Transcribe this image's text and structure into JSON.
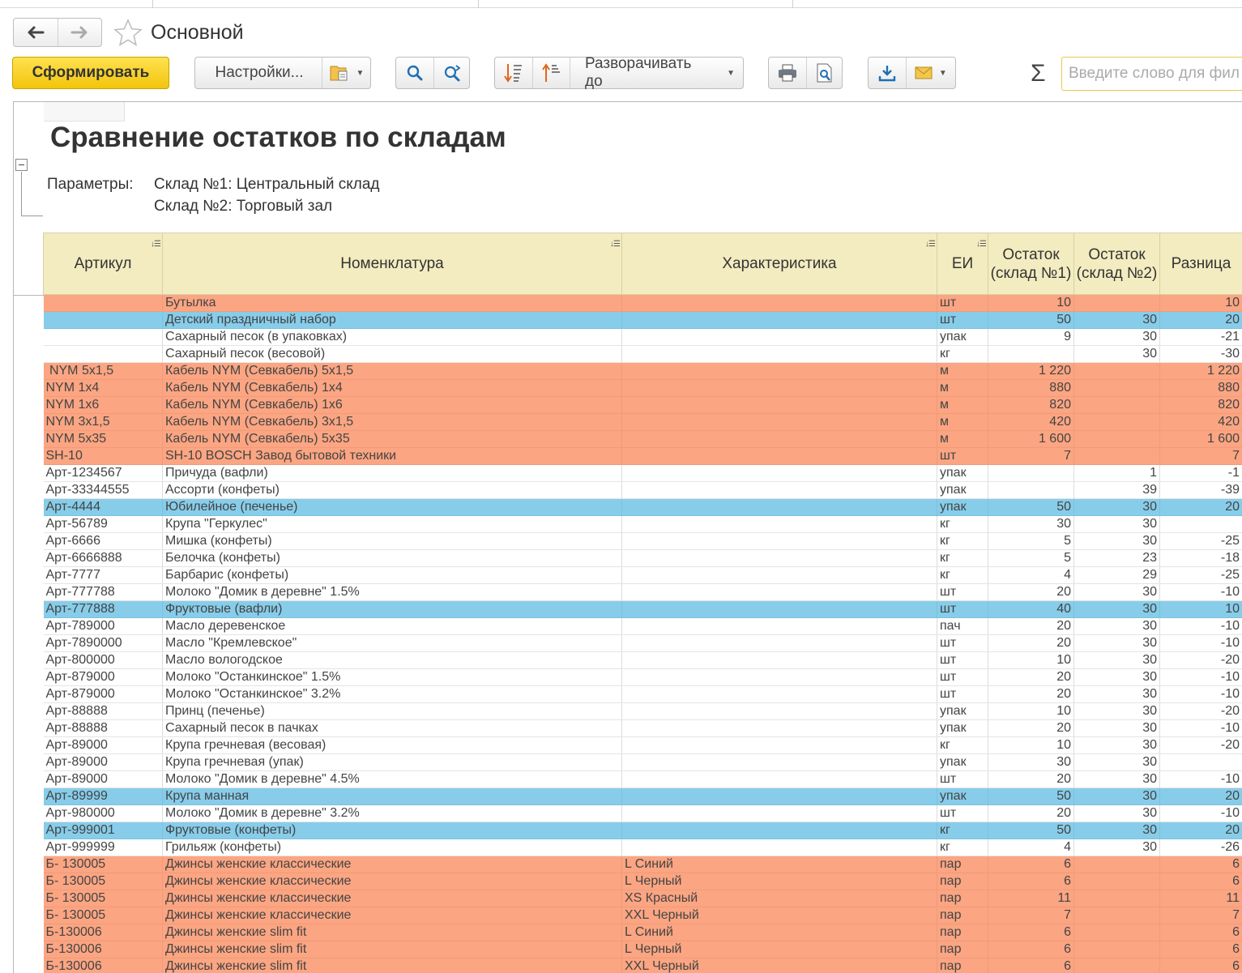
{
  "window": {
    "title": "Основной"
  },
  "toolbar": {
    "generate_label": "Сформировать",
    "settings_label": "Настройки...",
    "expand_label": "Разворачивать до",
    "search_placeholder": "Введите слово для фил"
  },
  "report": {
    "title": "Сравнение остатков по складам",
    "params_label": "Параметры:",
    "params": [
      "Склад №1: Центральный склад",
      "Склад №2: Торговый зал"
    ],
    "columns": [
      "Артикул",
      "Номенклатура",
      "Характеристика",
      "ЕИ",
      "Остаток (склад №1)",
      "Остаток (склад №2)",
      "Разница"
    ],
    "rows": [
      {
        "c": "red",
        "art": "",
        "name": "Бутылка",
        "char": "",
        "unit": "шт",
        "s1": "10",
        "s2": "",
        "diff": "10"
      },
      {
        "c": "blue",
        "art": "",
        "name": "Детский праздничный набор",
        "char": "",
        "unit": "шт",
        "s1": "50",
        "s2": "30",
        "diff": "20"
      },
      {
        "c": "white",
        "art": "",
        "name": "Сахарный песок (в упаковках)",
        "char": "",
        "unit": "упак",
        "s1": "9",
        "s2": "30",
        "diff": "-21"
      },
      {
        "c": "white",
        "art": "",
        "name": "Сахарный песок (весовой)",
        "char": "",
        "unit": "кг",
        "s1": "",
        "s2": "30",
        "diff": "-30"
      },
      {
        "c": "red",
        "art": " NYM 5х1,5",
        "name": "Кабель NYM (Севкабель) 5х1,5",
        "char": "",
        "unit": "м",
        "s1": "1 220",
        "s2": "",
        "diff": "1 220"
      },
      {
        "c": "red",
        "art": "NYM 1х4",
        "name": "Кабель NYM (Севкабель) 1х4",
        "char": "",
        "unit": "м",
        "s1": "880",
        "s2": "",
        "diff": "880"
      },
      {
        "c": "red",
        "art": "NYM 1х6",
        "name": "Кабель NYM (Севкабель) 1х6",
        "char": "",
        "unit": "м",
        "s1": "820",
        "s2": "",
        "diff": "820"
      },
      {
        "c": "red",
        "art": "NYM 3х1,5",
        "name": "Кабель NYM (Севкабель) 3х1,5",
        "char": "",
        "unit": "м",
        "s1": "420",
        "s2": "",
        "diff": "420"
      },
      {
        "c": "red",
        "art": "NYM 5х35",
        "name": "Кабель NYM (Севкабель) 5х35",
        "char": "",
        "unit": "м",
        "s1": "1 600",
        "s2": "",
        "diff": "1 600"
      },
      {
        "c": "red",
        "art": "SH-10",
        "name": "SH-10 BOSCH Завод бытовой техники",
        "char": "",
        "unit": "шт",
        "s1": "7",
        "s2": "",
        "diff": "7"
      },
      {
        "c": "white",
        "art": "Арт-1234567",
        "name": "Причуда (вафли)",
        "char": "",
        "unit": "упак",
        "s1": "",
        "s2": "1",
        "diff": "-1"
      },
      {
        "c": "white",
        "art": "Арт-33344555",
        "name": "Ассорти (конфеты)",
        "char": "",
        "unit": "упак",
        "s1": "",
        "s2": "39",
        "diff": "-39"
      },
      {
        "c": "blue",
        "art": "Арт-4444",
        "name": "Юбилейное (печенье)",
        "char": "",
        "unit": "упак",
        "s1": "50",
        "s2": "30",
        "diff": "20"
      },
      {
        "c": "white",
        "art": "Арт-56789",
        "name": "Крупа \"Геркулес\"",
        "char": "",
        "unit": "кг",
        "s1": "30",
        "s2": "30",
        "diff": ""
      },
      {
        "c": "white",
        "art": "Арт-6666",
        "name": "Мишка (конфеты)",
        "char": "",
        "unit": "кг",
        "s1": "5",
        "s2": "30",
        "diff": "-25"
      },
      {
        "c": "white",
        "art": "Арт-6666888",
        "name": "Белочка (конфеты)",
        "char": "",
        "unit": "кг",
        "s1": "5",
        "s2": "23",
        "diff": "-18"
      },
      {
        "c": "white",
        "art": "Арт-7777",
        "name": "Барбарис (конфеты)",
        "char": "",
        "unit": "кг",
        "s1": "4",
        "s2": "29",
        "diff": "-25"
      },
      {
        "c": "white",
        "art": "Арт-777788",
        "name": "Молоко \"Домик в деревне\" 1.5%",
        "char": "",
        "unit": "шт",
        "s1": "20",
        "s2": "30",
        "diff": "-10"
      },
      {
        "c": "blue",
        "art": "Арт-777888",
        "name": "Фруктовые (вафли)",
        "char": "",
        "unit": "шт",
        "s1": "40",
        "s2": "30",
        "diff": "10"
      },
      {
        "c": "white",
        "art": "Арт-789000",
        "name": "Масло деревенское",
        "char": "",
        "unit": "пач",
        "s1": "20",
        "s2": "30",
        "diff": "-10"
      },
      {
        "c": "white",
        "art": "Арт-7890000",
        "name": "Масло \"Кремлевское\"",
        "char": "",
        "unit": "шт",
        "s1": "20",
        "s2": "30",
        "diff": "-10"
      },
      {
        "c": "white",
        "art": "Арт-800000",
        "name": "Масло вологодское",
        "char": "",
        "unit": "шт",
        "s1": "10",
        "s2": "30",
        "diff": "-20"
      },
      {
        "c": "white",
        "art": "Арт-879000",
        "name": "Молоко \"Останкинское\" 1.5%",
        "char": "",
        "unit": "шт",
        "s1": "20",
        "s2": "30",
        "diff": "-10"
      },
      {
        "c": "white",
        "art": "Арт-879000",
        "name": "Молоко \"Останкинское\" 3.2%",
        "char": "",
        "unit": "шт",
        "s1": "20",
        "s2": "30",
        "diff": "-10"
      },
      {
        "c": "white",
        "art": "Арт-88888",
        "name": "Принц (печенье)",
        "char": "",
        "unit": "упак",
        "s1": "10",
        "s2": "30",
        "diff": "-20"
      },
      {
        "c": "white",
        "art": "Арт-88888",
        "name": "Сахарный песок в пачках",
        "char": "",
        "unit": "упак",
        "s1": "20",
        "s2": "30",
        "diff": "-10"
      },
      {
        "c": "white",
        "art": "Арт-89000",
        "name": "Крупа гречневая (весовая)",
        "char": "",
        "unit": "кг",
        "s1": "10",
        "s2": "30",
        "diff": "-20"
      },
      {
        "c": "white",
        "art": "Арт-89000",
        "name": "Крупа гречневая (упак)",
        "char": "",
        "unit": "упак",
        "s1": "30",
        "s2": "30",
        "diff": ""
      },
      {
        "c": "white",
        "art": "Арт-89000",
        "name": "Молоко \"Домик в деревне\" 4.5%",
        "char": "",
        "unit": "шт",
        "s1": "20",
        "s2": "30",
        "diff": "-10"
      },
      {
        "c": "blue",
        "art": "Арт-89999",
        "name": "Крупа манная",
        "char": "",
        "unit": "упак",
        "s1": "50",
        "s2": "30",
        "diff": "20"
      },
      {
        "c": "white",
        "art": "Арт-980000",
        "name": "Молоко \"Домик в деревне\" 3.2%",
        "char": "",
        "unit": "шт",
        "s1": "20",
        "s2": "30",
        "diff": "-10"
      },
      {
        "c": "blue",
        "art": "Арт-999001",
        "name": "Фруктовые (конфеты)",
        "char": "",
        "unit": "кг",
        "s1": "50",
        "s2": "30",
        "diff": "20"
      },
      {
        "c": "white",
        "art": "Арт-999999",
        "name": "Грильяж (конфеты)",
        "char": "",
        "unit": "кг",
        "s1": "4",
        "s2": "30",
        "diff": "-26"
      },
      {
        "c": "red",
        "art": "Б- 130005",
        "name": "Джинсы женские классические",
        "char": "L Синий",
        "unit": "пар",
        "s1": "6",
        "s2": "",
        "diff": "6"
      },
      {
        "c": "red",
        "art": "Б- 130005",
        "name": "Джинсы женские классические",
        "char": "L Черный",
        "unit": "пар",
        "s1": "6",
        "s2": "",
        "diff": "6"
      },
      {
        "c": "red",
        "art": "Б- 130005",
        "name": "Джинсы женские классические",
        "char": "XS Красный",
        "unit": "пар",
        "s1": "11",
        "s2": "",
        "diff": "11"
      },
      {
        "c": "red",
        "art": "Б- 130005",
        "name": "Джинсы женские классические",
        "char": "XXL Черный",
        "unit": "пар",
        "s1": "7",
        "s2": "",
        "diff": "7"
      },
      {
        "c": "red",
        "art": "Б-130006",
        "name": "Джинсы женские slim fit",
        "char": "L Синий",
        "unit": "пар",
        "s1": "6",
        "s2": "",
        "diff": "6"
      },
      {
        "c": "red",
        "art": "Б-130006",
        "name": "Джинсы женские slim fit",
        "char": "L Черный",
        "unit": "пар",
        "s1": "6",
        "s2": "",
        "diff": "6"
      },
      {
        "c": "red",
        "art": "Б-130006",
        "name": "Джинсы женские slim fit",
        "char": "XXL Черный",
        "unit": "пар",
        "s1": "6",
        "s2": "",
        "diff": "6"
      }
    ]
  },
  "colors": {
    "row_red": "#fba582",
    "row_blue": "#87cdea",
    "header_bg": "#f3ecc0",
    "primary_button": "#f2c40c"
  },
  "icons": [
    "back-arrow-icon",
    "forward-arrow-icon",
    "favorite-star-icon",
    "settings-variant-icon",
    "search-icon",
    "search-next-icon",
    "sort-descending-icon",
    "sort-ascending-icon",
    "print-icon",
    "print-preview-icon",
    "save-icon",
    "email-icon",
    "sum-icon",
    "collapse-group-icon",
    "column-sort-icon"
  ]
}
